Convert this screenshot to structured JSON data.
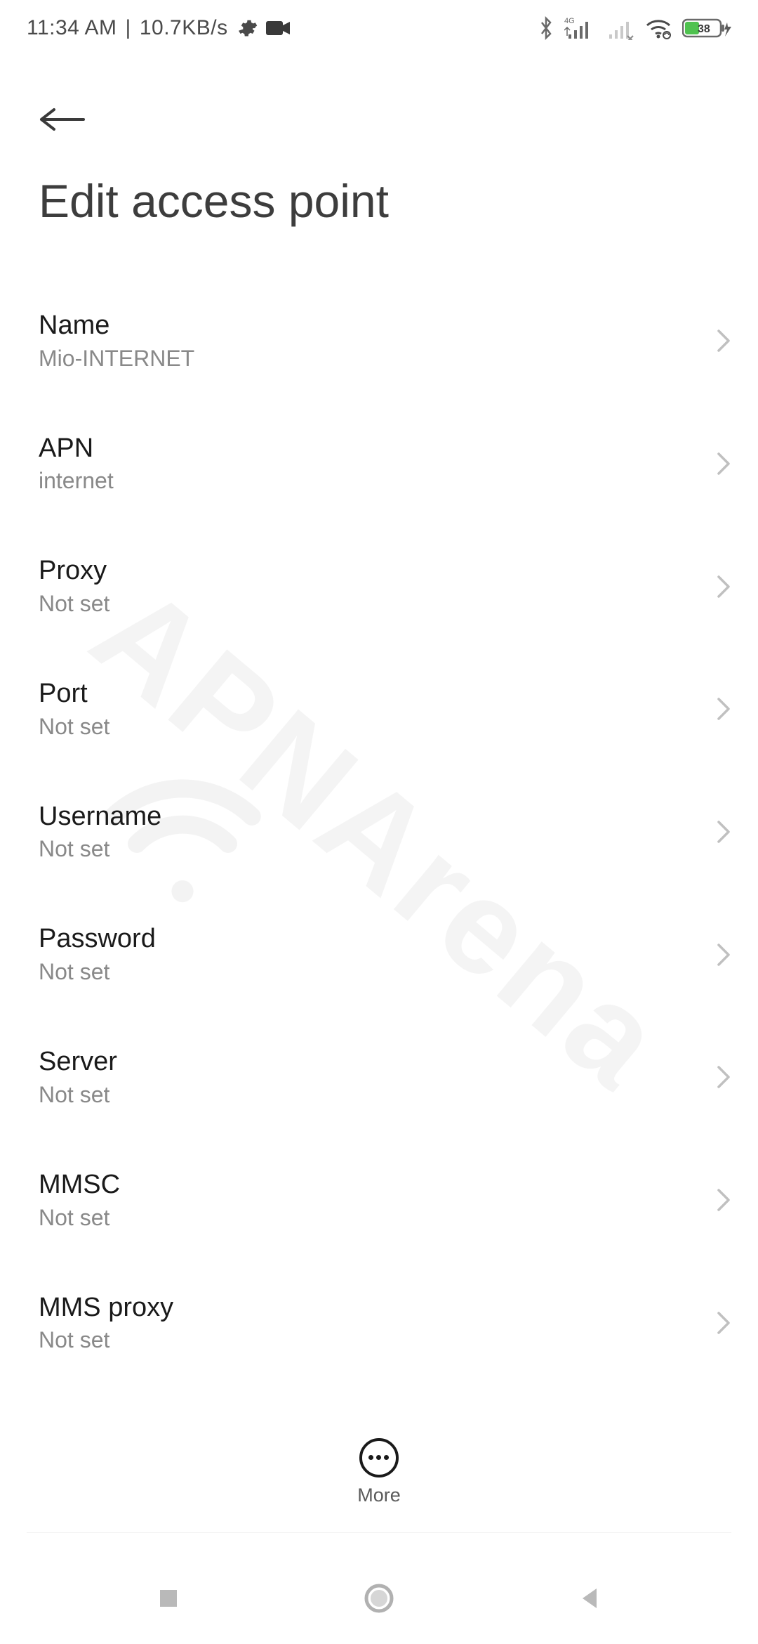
{
  "status": {
    "time": "11:34 AM",
    "separator": "|",
    "net_speed": "10.7KB/s",
    "battery_pct": "38",
    "network_label": "4G"
  },
  "header": {
    "title": "Edit access point"
  },
  "settings": [
    {
      "label": "Name",
      "value": "Mio-INTERNET"
    },
    {
      "label": "APN",
      "value": "internet"
    },
    {
      "label": "Proxy",
      "value": "Not set"
    },
    {
      "label": "Port",
      "value": "Not set"
    },
    {
      "label": "Username",
      "value": "Not set"
    },
    {
      "label": "Password",
      "value": "Not set"
    },
    {
      "label": "Server",
      "value": "Not set"
    },
    {
      "label": "MMSC",
      "value": "Not set"
    },
    {
      "label": "MMS proxy",
      "value": "Not set"
    }
  ],
  "bottom": {
    "more_label": "More"
  },
  "watermark": {
    "text": "APNArena"
  }
}
